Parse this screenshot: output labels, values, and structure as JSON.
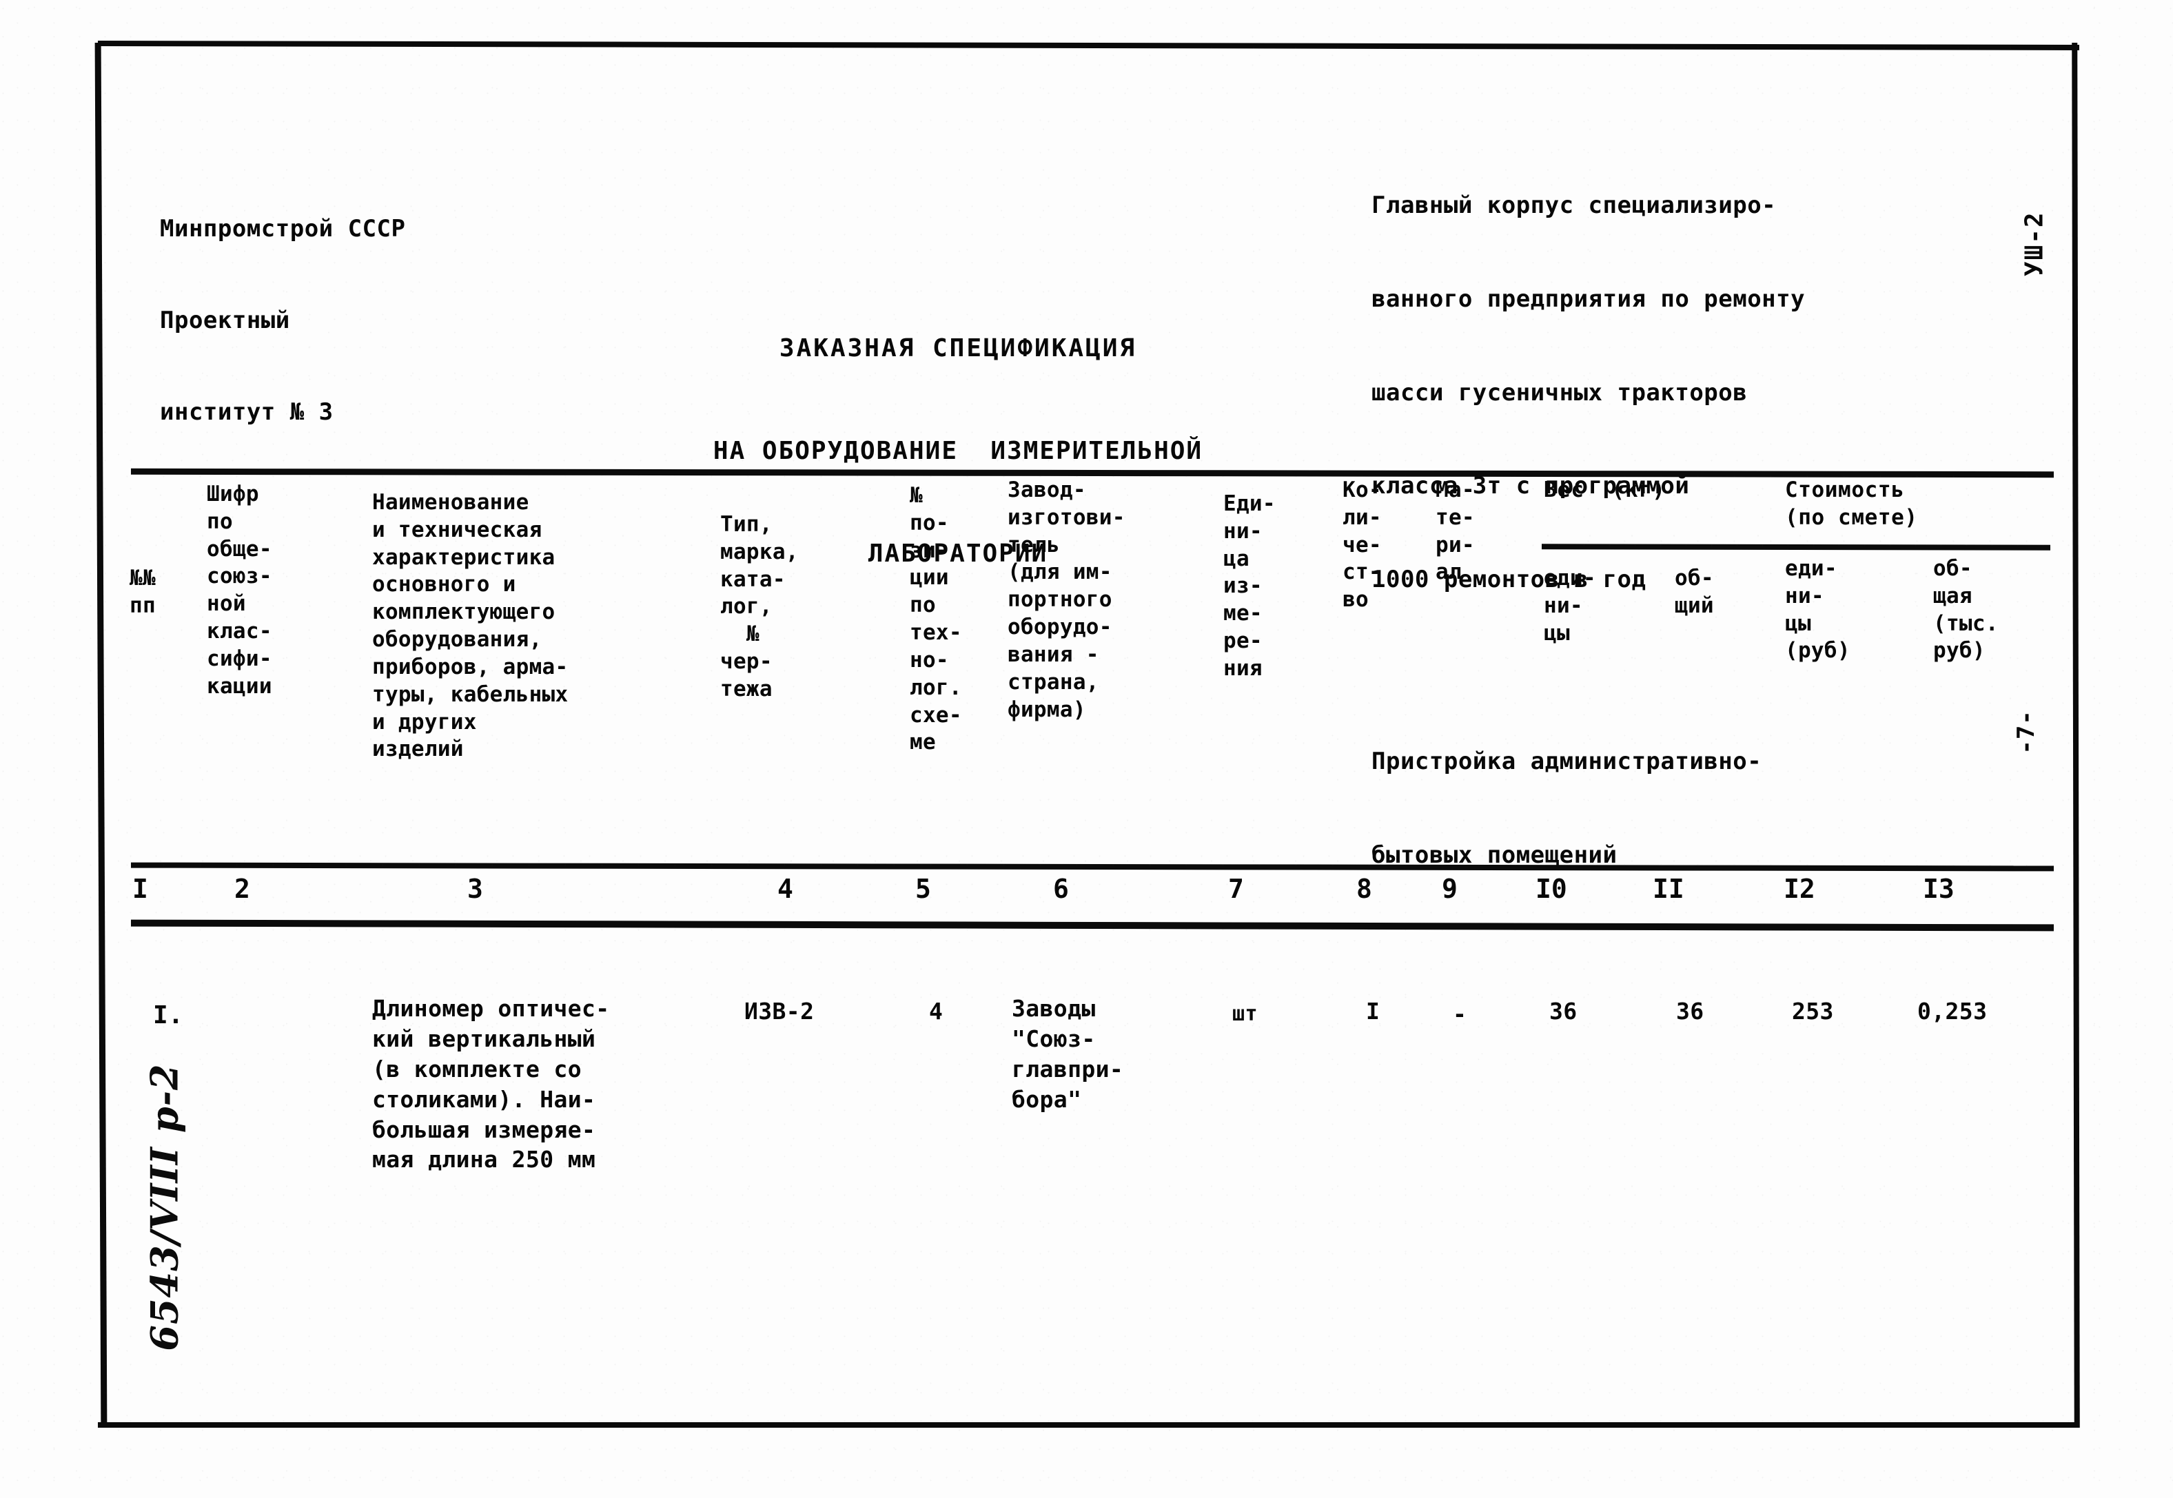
{
  "document": {
    "organization": {
      "line1": "Минпромстрой СССР",
      "line2": "Проектный",
      "line3": "институт № 3"
    },
    "title": {
      "line1": "ЗАКАЗНАЯ СПЕЦИФИКАЦИЯ",
      "line2": "НА ОБОРУДОВАНИЕ  ИЗМЕРИТЕЛЬНОЙ",
      "line3": "ЛАБОРАТОРИИ"
    },
    "project": {
      "line1": "Главный корпус специализиро-",
      "line2": "ванного предприятия по ремонту",
      "line3": "шасси гусеничных тракторов",
      "line4": "класса 3т с программой",
      "line5": "1000 ремонтов в год",
      "line6": "Пристройка административно-",
      "line7": "бытовых помещений"
    },
    "sheet_code": "УШ-2",
    "page_number": "-7-",
    "handwritten_note": "6543/VIII р-2"
  },
  "table": {
    "headers": {
      "col1": "№№\nпп",
      "col2": "Шифр\nпо\nобще-\nсоюз-\nной\nклас-\nсифи-\nкации",
      "col3": "Наименование\nи техническая\nхарактеристика\nосновного и\nкомплектующего\nоборудования,\nприборов, арма-\nтуры, кабельных\nи других\nизделий",
      "col4": "Тип,\nмарка,\nката-\nлог,\n  №\nчер-\nтежа",
      "col5": "№\nпо-\nзи-\nции\nпо\nтех-\nно-\nлог.\nсхе-\nме",
      "col6": "Завод-\nизготови-\nтель\n(для им-\nпортного\nоборудо-\nвания -\nстрана,\nфирма)",
      "col7": "Еди-\nни-\nца\nиз-\nме-\nре-\nния",
      "col8": "Ко-\nли-\nче-\nст-\nво",
      "col9": "Ма-\nте-\nри-\nал",
      "span_weight": "Вес  (кг)",
      "span_cost": "Стоимость\n(по смете)",
      "col10": "еди-\nни-\nцы",
      "col11": "об-\nщий",
      "col12": "еди-\nни-\nцы\n(руб)",
      "col13": "об-\nщая\n(тыс.\nруб)"
    },
    "column_numbers": {
      "n1": "I",
      "n2": "2",
      "n3": "3",
      "n4": "4",
      "n5": "5",
      "n6": "6",
      "n7": "7",
      "n8": "8",
      "n9": "9",
      "n10": "I0",
      "n11": "II",
      "n12": "I2",
      "n13": "I3"
    },
    "rows": [
      {
        "no": "I.",
        "classifier_code": "",
        "name": "Длиномер оптичес-\nкий вертикальный\n(в комплекте со\nстоликами). Наи-\nбольшая измеряе-\nмая длина 250 мм",
        "type_mark": "ИЗВ-2",
        "position": "4",
        "manufacturer": "Заводы\n\"Союз-\nглавпри-\nбора\"",
        "unit": "шт",
        "quantity": "I",
        "material": "-",
        "weight_unit": "36",
        "weight_total": "36",
        "cost_unit": "253",
        "cost_total": "0,253"
      }
    ]
  }
}
